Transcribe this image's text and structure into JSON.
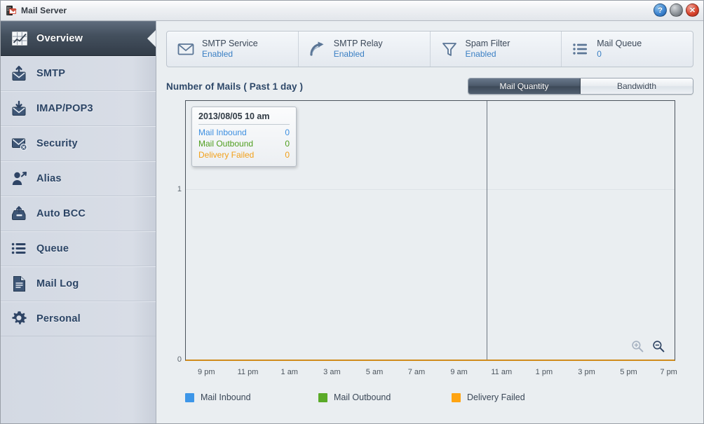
{
  "window": {
    "title": "Mail Server",
    "icon": "mail-server-icon",
    "buttons": [
      {
        "name": "help-button",
        "glyph": "?"
      },
      {
        "name": "minimize-button",
        "glyph": ""
      },
      {
        "name": "close-button",
        "glyph": "✕"
      }
    ]
  },
  "sidebar": {
    "items": [
      {
        "label": "Overview",
        "icon": "chart-grid-icon",
        "active": true
      },
      {
        "label": "SMTP",
        "icon": "mail-upload-icon",
        "active": false
      },
      {
        "label": "IMAP/POP3",
        "icon": "mail-download-icon",
        "active": false
      },
      {
        "label": "Security",
        "icon": "mail-block-icon",
        "active": false
      },
      {
        "label": "Alias",
        "icon": "user-arrow-icon",
        "active": false
      },
      {
        "label": "Auto BCC",
        "icon": "tray-arrow-icon",
        "active": false
      },
      {
        "label": "Queue",
        "icon": "list-icon",
        "active": false
      },
      {
        "label": "Mail Log",
        "icon": "document-icon",
        "active": false
      },
      {
        "label": "Personal",
        "icon": "gear-icon",
        "active": false
      }
    ]
  },
  "status_panel": {
    "cells": [
      {
        "name": "SMTP Service",
        "value": "Enabled",
        "icon": "envelope-icon"
      },
      {
        "name": "SMTP Relay",
        "value": "Enabled",
        "icon": "relay-arrow-icon"
      },
      {
        "name": "Spam Filter",
        "value": "Enabled",
        "icon": "funnel-icon"
      },
      {
        "name": "Mail Queue",
        "value": "0",
        "icon": "list-icon"
      }
    ]
  },
  "chart_header": {
    "title": "Number of Mails ( Past 1 day )",
    "toggles": [
      {
        "label": "Mail Quantity",
        "selected": true
      },
      {
        "label": "Bandwidth",
        "selected": false
      }
    ]
  },
  "tooltip": {
    "title": "2013/08/05 10 am",
    "rows": [
      {
        "label": "Mail Inbound",
        "value": "0",
        "color": "#3d8fe0"
      },
      {
        "label": "Mail Outbound",
        "value": "0",
        "color": "#4f9e1f"
      },
      {
        "label": "Delivery Failed",
        "value": "0",
        "color": "#f2a01a"
      }
    ]
  },
  "zoom_controls": [
    {
      "name": "zoom-in-button",
      "enabled": false
    },
    {
      "name": "zoom-out-button",
      "enabled": true
    }
  ],
  "chart_data": {
    "type": "line",
    "title": "Number of Mails ( Past 1 day )",
    "xlabel": "",
    "ylabel": "",
    "ylim": [
      0,
      1
    ],
    "yticks": [
      0,
      1
    ],
    "ytick_labels": [
      "0",
      "1"
    ],
    "grid": true,
    "legend_position": "bottom",
    "x": [
      "9 pm",
      "11 pm",
      "1 am",
      "3 am",
      "5 am",
      "7 am",
      "9 am",
      "11 am",
      "1 pm",
      "3 pm",
      "5 pm",
      "7 pm"
    ],
    "xtick_labels": [
      "9 pm",
      "11 pm",
      "1 am",
      "3 am",
      "5 am",
      "7 am",
      "9 am",
      "11 am",
      "1 pm",
      "3 pm",
      "5 pm",
      "7 pm"
    ],
    "series": [
      {
        "name": "Mail Inbound",
        "color": "#3d96e8",
        "values": [
          0,
          0,
          0,
          0,
          0,
          0,
          0,
          0,
          0,
          0,
          0,
          0
        ]
      },
      {
        "name": "Mail Outbound",
        "color": "#5aaa28",
        "values": [
          0,
          0,
          0,
          0,
          0,
          0,
          0,
          0,
          0,
          0,
          0,
          0
        ]
      },
      {
        "name": "Delivery Failed",
        "color": "#ffa412",
        "values": [
          0,
          0,
          0,
          0,
          0,
          0,
          0,
          0,
          0,
          0,
          0,
          0
        ]
      }
    ],
    "annotations": [
      {
        "type": "vline",
        "at": "day-boundary",
        "position_pct": 61.5
      }
    ]
  },
  "legend": [
    {
      "label": "Mail Inbound",
      "color": "#3d96e8"
    },
    {
      "label": "Mail Outbound",
      "color": "#5aaa28"
    },
    {
      "label": "Delivery Failed",
      "color": "#ffa412"
    }
  ]
}
